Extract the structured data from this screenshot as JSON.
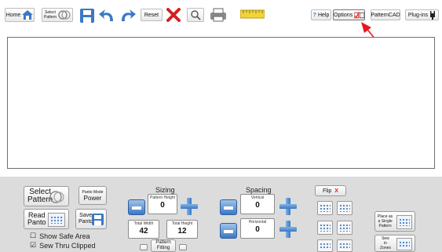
{
  "toolbar": {
    "home_label": "Home",
    "select_pattern_label": "Select Pattern",
    "reset_label": "Reset",
    "help_label": "Help",
    "options_label": "Options",
    "patterncad_label": "PatternCAD",
    "plugins_label": "Plug-ins"
  },
  "bottom": {
    "select_pattern_line1": "Select",
    "select_pattern_line2": "Pattern",
    "panto_mode_line1": "Panto Mode",
    "panto_mode_line2": "Power",
    "read_panto_line1": "Read",
    "read_panto_line2": "Panto",
    "save_panto_line1": "Save",
    "save_panto_line2": "Panto",
    "show_safe_area": "Show Safe Area",
    "sew_thru_clipped": "Sew Thru Clipped",
    "show_safe_area_mark": "☐",
    "sew_thru_clipped_mark": "☑"
  },
  "sizing": {
    "title": "Sizing",
    "pattern_height_caption": "Pattern Height",
    "pattern_height_value": "0",
    "total_width_caption": "Total Width",
    "total_width_value": "42",
    "total_height_caption": "Total Height",
    "total_height_value": "12",
    "pattern_fitting_line1": "Pattern",
    "pattern_fitting_line2": "Fitting"
  },
  "spacing": {
    "title": "Spacing",
    "vertical_caption": "Vertical",
    "vertical_value": "0",
    "horizontal_caption": "Horizontal",
    "horizontal_value": "0"
  },
  "flip": {
    "label": "Flip",
    "x_mark": "X"
  },
  "place": {
    "single_line1": "Place as",
    "single_line2": "a Single",
    "single_line3": "Pattern",
    "zones_line1": "Sew",
    "zones_line2": "in",
    "zones_line3": "Zones"
  },
  "colors": {
    "accent_blue": "#3b78c4",
    "red_x": "#d42020",
    "annotation_arrow": "#e8181f",
    "panel_bg": "#dcdcdc"
  }
}
